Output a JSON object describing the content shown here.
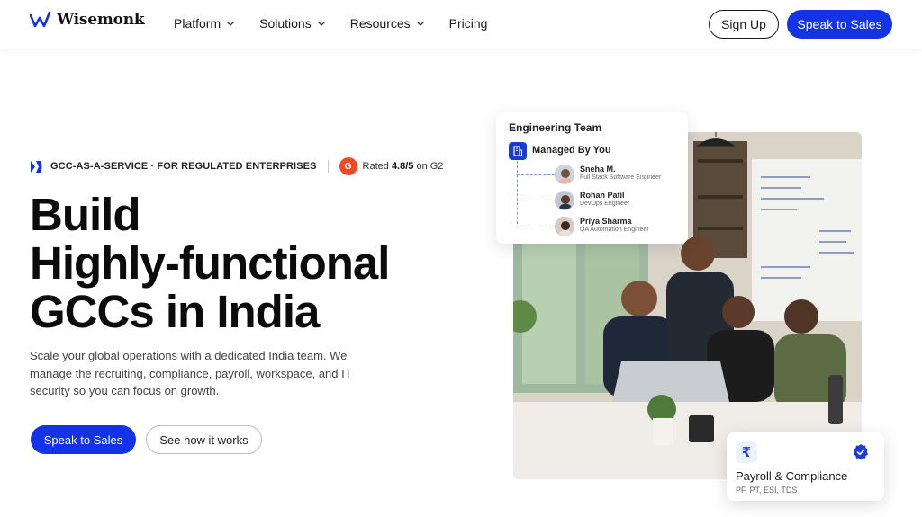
{
  "brand": {
    "name": "Wisemonk",
    "accent": "#1233e6"
  },
  "nav": {
    "items": [
      {
        "label": "Platform",
        "dropdown": true
      },
      {
        "label": "Solutions",
        "dropdown": true
      },
      {
        "label": "Resources",
        "dropdown": true
      },
      {
        "label": "Pricing",
        "dropdown": false
      }
    ],
    "signup_label": "Sign Up",
    "sales_label": "Speak to Sales"
  },
  "hero": {
    "badge_text": "GCC-AS-A-SERVICE · FOR REGULATED ENTERPRISES",
    "g2_logo_text": "G",
    "rating_prefix": "Rated ",
    "rating_value": "4.8/5",
    "rating_suffix": " on G2",
    "headline": [
      "Build",
      "Highly-functional",
      "GCCs in India"
    ],
    "subtext": "Scale your global operations with a dedicated India team. We manage the recruiting, compliance, payroll, workspace, and IT security so you can focus on growth.",
    "primary_cta": "Speak to Sales",
    "secondary_cta": "See how it works"
  },
  "engineering_card": {
    "title": "Engineering Team",
    "managed_label": "Managed By You",
    "members": [
      {
        "name": "Sneha M.",
        "role": "Full Stack Software Engineer"
      },
      {
        "name": "Rohan Patil",
        "role": "DevOps Engineer"
      },
      {
        "name": "Priya Sharma",
        "role": "QA Automation Engineer"
      }
    ]
  },
  "payroll_card": {
    "icon_glyph": "₹",
    "title": "Payroll & Compliance",
    "subtitle": "PF, PT, ESI, TDS"
  }
}
